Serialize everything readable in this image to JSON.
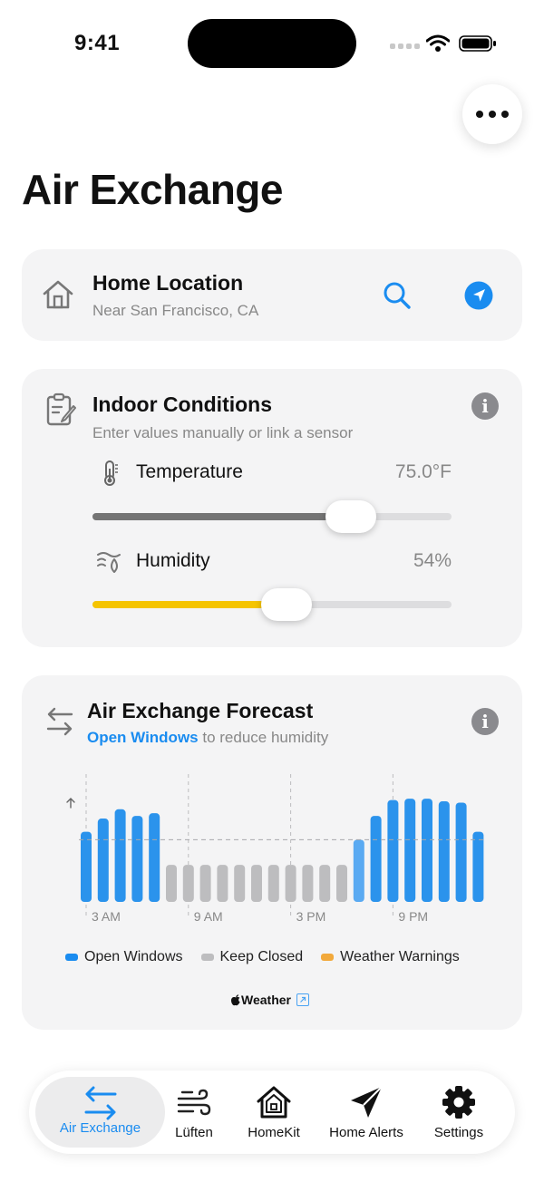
{
  "status": {
    "time": "9:41"
  },
  "page": {
    "title": "Air Exchange"
  },
  "location": {
    "title": "Home Location",
    "subtitle": "Near San Francisco, CA"
  },
  "indoor": {
    "title": "Indoor Conditions",
    "subtitle": "Enter values manually or link a sensor",
    "temperature": {
      "label": "Temperature",
      "value": "75.0°F",
      "slider_fraction": 0.72
    },
    "humidity": {
      "label": "Humidity",
      "value": "54%",
      "slider_fraction": 0.54
    }
  },
  "forecast": {
    "title": "Air Exchange Forecast",
    "subtitle_link": "Open Windows",
    "subtitle_rest": " to reduce humidity",
    "legend": [
      {
        "label": "Open Windows",
        "color": "#1a8cf0"
      },
      {
        "label": "Keep Closed",
        "color": "#bdbdbf"
      },
      {
        "label": "Weather Warnings",
        "color": "#f2a93b"
      }
    ],
    "attribution": "Weather"
  },
  "chart_data": {
    "type": "bar",
    "categories": [
      "3 AM",
      "9 AM",
      "3 PM",
      "9 PM"
    ],
    "series": [
      {
        "name": "Open Windows",
        "color": "#2b93ec"
      },
      {
        "name": "Keep Closed",
        "color": "#bdbdbf"
      }
    ],
    "values": [
      0.53,
      0.63,
      0.7,
      0.65,
      0.67,
      0.28,
      0.28,
      0.28,
      0.28,
      0.28,
      0.28,
      0.28,
      0.28,
      0.28,
      0.28,
      0.28,
      0.47,
      0.65,
      0.77,
      0.78,
      0.78,
      0.76,
      0.75,
      0.53
    ],
    "status": [
      "open",
      "open",
      "open",
      "open",
      "open",
      "closed",
      "closed",
      "closed",
      "closed",
      "closed",
      "closed",
      "closed",
      "closed",
      "closed",
      "closed",
      "closed",
      "open",
      "open",
      "open",
      "open",
      "open",
      "open",
      "open",
      "open"
    ],
    "threshold": 0.47,
    "xlabel": "",
    "ylabel": ""
  },
  "tabs": [
    {
      "label": "Air Exchange",
      "icon": "arrows-exchange-icon",
      "selected": true
    },
    {
      "label": "Lüften",
      "icon": "wind-icon",
      "selected": false
    },
    {
      "label": "HomeKit",
      "icon": "home-icon",
      "selected": false
    },
    {
      "label": "Home Alerts",
      "icon": "paper-plane-icon",
      "selected": false
    },
    {
      "label": "Settings",
      "icon": "gear-icon",
      "selected": false
    }
  ],
  "colors": {
    "accent": "#1a8cf0",
    "humidity_fill": "#f5c400",
    "temp_fill": "#747474"
  }
}
